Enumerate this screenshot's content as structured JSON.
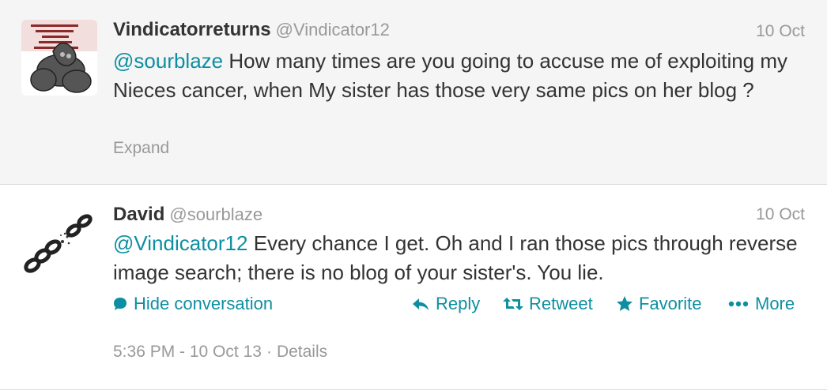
{
  "tweets": [
    {
      "fullname": "Vindicatorreturns",
      "screenname": "@Vindicator12",
      "time": "10 Oct",
      "mention": "@sourblaze",
      "text": " How many times are you going to accuse me of exploiting my Nieces cancer, when My sister has those very same pics on her blog ?",
      "expand": "Expand",
      "avatar": "gargoyle-avatar"
    },
    {
      "fullname": "David",
      "screenname": "@sourblaze",
      "time": "10 Oct",
      "mention": "@Vindicator12",
      "text": " Every chance I get. Oh and I ran those pics through reverse image search; there is no blog of your sister's. You lie.",
      "avatar": "broken-chain-avatar",
      "actions": {
        "hide_conversation": "Hide conversation",
        "reply": "Reply",
        "retweet": "Retweet",
        "favorite": "Favorite",
        "more": "More"
      },
      "timestamp": "5:36 PM - 10 Oct 13",
      "separator": "·",
      "details": "Details"
    }
  ],
  "colors": {
    "link": "#0e8fa1",
    "muted": "#999999",
    "text": "#333333",
    "expanded_bg": "#f5f5f5"
  },
  "icons": [
    "speech-bubble-icon",
    "reply-arrow-icon",
    "retweet-icon",
    "star-icon",
    "ellipsis-icon"
  ]
}
